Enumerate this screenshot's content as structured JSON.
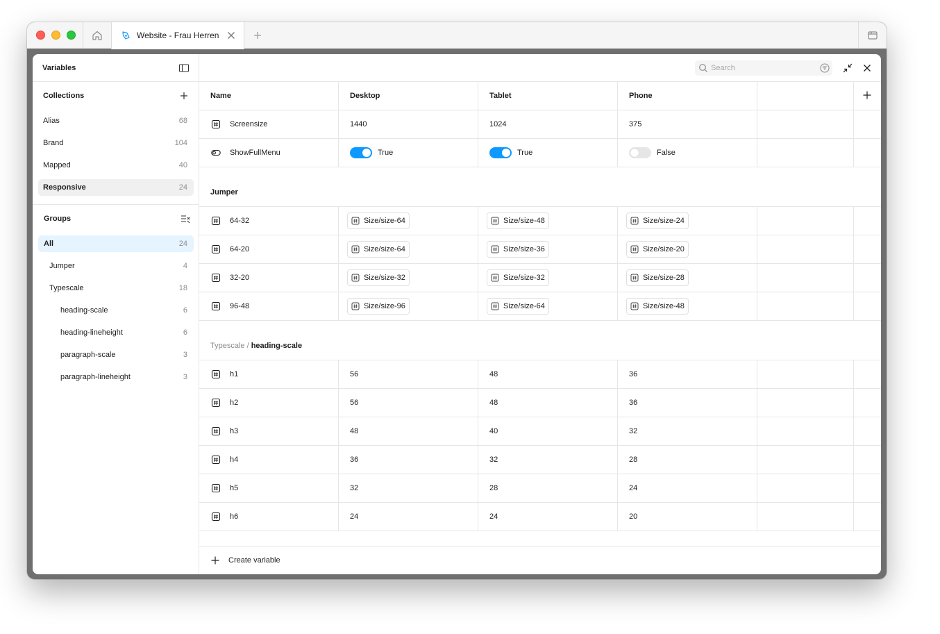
{
  "browser": {
    "tab_title": "Website - Frau Herren",
    "icons": [
      "home-icon",
      "figma-file-icon",
      "close-icon",
      "plus-icon",
      "sidebar-icon"
    ]
  },
  "sidebar": {
    "title": "Variables",
    "collections_title": "Collections",
    "collections": [
      {
        "label": "Alias",
        "count": "68"
      },
      {
        "label": "Brand",
        "count": "104"
      },
      {
        "label": "Mapped",
        "count": "40"
      },
      {
        "label": "Responsive",
        "count": "24"
      }
    ],
    "groups_title": "Groups",
    "groups": [
      {
        "label": "All",
        "count": "24"
      },
      {
        "label": "Jumper",
        "count": "4"
      },
      {
        "label": "Typescale",
        "count": "18"
      },
      {
        "label": "heading-scale",
        "count": "6"
      },
      {
        "label": "heading-lineheight",
        "count": "6"
      },
      {
        "label": "paragraph-scale",
        "count": "3"
      },
      {
        "label": "paragraph-lineheight",
        "count": "3"
      }
    ]
  },
  "search": {
    "placeholder": "Search"
  },
  "columns": {
    "name": "Name",
    "desktop": "Desktop",
    "tablet": "Tablet",
    "phone": "Phone"
  },
  "ungrouped": [
    {
      "name": "Screensize",
      "desktop": "1440",
      "tablet": "1024",
      "phone": "375"
    },
    {
      "name": "ShowFullMenu",
      "desktop": "True",
      "tablet": "True",
      "phone": "False",
      "desktop_on": true,
      "tablet_on": true,
      "phone_on": false
    }
  ],
  "jumper": {
    "title": "Jumper",
    "rows": [
      {
        "name": "64-32",
        "desktop": "Size/size-64",
        "tablet": "Size/size-48",
        "phone": "Size/size-24"
      },
      {
        "name": "64-20",
        "desktop": "Size/size-64",
        "tablet": "Size/size-36",
        "phone": "Size/size-20"
      },
      {
        "name": "32-20",
        "desktop": "Size/size-32",
        "tablet": "Size/size-32",
        "phone": "Size/size-28"
      },
      {
        "name": "96-48",
        "desktop": "Size/size-96",
        "tablet": "Size/size-64",
        "phone": "Size/size-48"
      }
    ]
  },
  "heading_scale": {
    "parent": "Typescale",
    "separator": " / ",
    "title": "heading-scale",
    "rows": [
      {
        "name": "h1",
        "desktop": "56",
        "tablet": "48",
        "phone": "36"
      },
      {
        "name": "h2",
        "desktop": "56",
        "tablet": "48",
        "phone": "36"
      },
      {
        "name": "h3",
        "desktop": "48",
        "tablet": "40",
        "phone": "32"
      },
      {
        "name": "h4",
        "desktop": "36",
        "tablet": "32",
        "phone": "28"
      },
      {
        "name": "h5",
        "desktop": "32",
        "tablet": "28",
        "phone": "24"
      },
      {
        "name": "h6",
        "desktop": "24",
        "tablet": "24",
        "phone": "20"
      }
    ]
  },
  "footer": {
    "create_label": "Create variable"
  },
  "colors": {
    "accent": "#0d99ff",
    "selected_bg": "#e5f4ff",
    "active_bg": "#f0f0f0",
    "border": "#e6e6e6"
  }
}
